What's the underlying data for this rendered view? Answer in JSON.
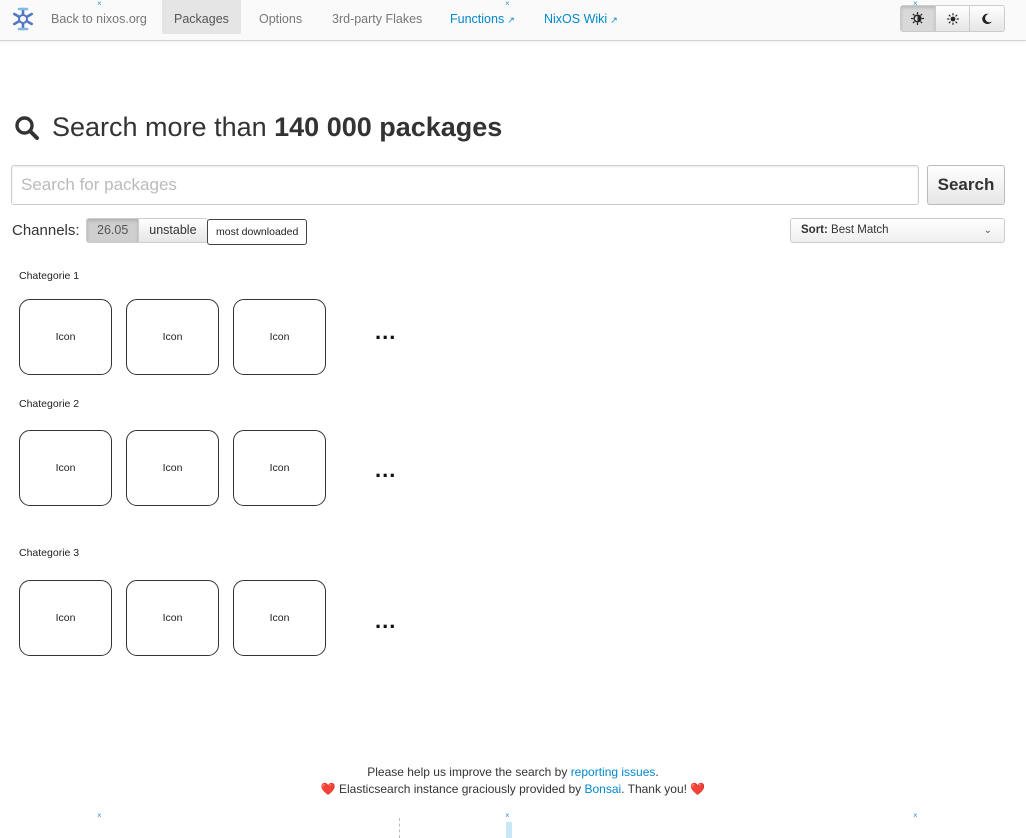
{
  "nav": {
    "items": [
      {
        "label": "Back to nixos.org"
      },
      {
        "label": "Packages"
      },
      {
        "label": "Options"
      },
      {
        "label": "3rd-party Flakes"
      },
      {
        "label": "Functions"
      },
      {
        "label": "NixOS Wiki"
      }
    ],
    "external_marker": "↗",
    "theme_buttons": [
      {
        "icon": "auto-theme-icon"
      },
      {
        "icon": "sun-icon"
      },
      {
        "icon": "moon-icon"
      }
    ]
  },
  "heading": {
    "prefix": "Search more than",
    "count": "140 000 packages"
  },
  "search": {
    "placeholder": "Search for packages",
    "value": "",
    "button_label": "Search"
  },
  "channels": {
    "label": "Channels:",
    "options": [
      "26.05",
      "unstable"
    ],
    "selected": "26.05",
    "most_downloaded_label": "most downloaded"
  },
  "sort": {
    "label": "Sort:",
    "value": "Best Match"
  },
  "categories": [
    {
      "name": "Chategorie 1",
      "icons": [
        "Icon",
        "Icon",
        "Icon"
      ],
      "more": "..."
    },
    {
      "name": "Chategorie 2",
      "icons": [
        "Icon",
        "Icon",
        "Icon"
      ],
      "more": "..."
    },
    {
      "name": "Chategorie 3",
      "icons": [
        "Icon",
        "Icon",
        "Icon"
      ],
      "more": "..."
    }
  ],
  "footer": {
    "line1_prefix": "Please help us improve the search by",
    "line1_link": "reporting issues",
    "line1_suffix": ".",
    "line2_prefix": "Elasticsearch instance graciously provided by",
    "line2_link": "Bonsai",
    "line2_suffix": ". Thank you!",
    "heart": "❤️"
  },
  "colors": {
    "link": "#0088cc",
    "heart": "#dd3333",
    "marker": "#3a8fd8"
  }
}
